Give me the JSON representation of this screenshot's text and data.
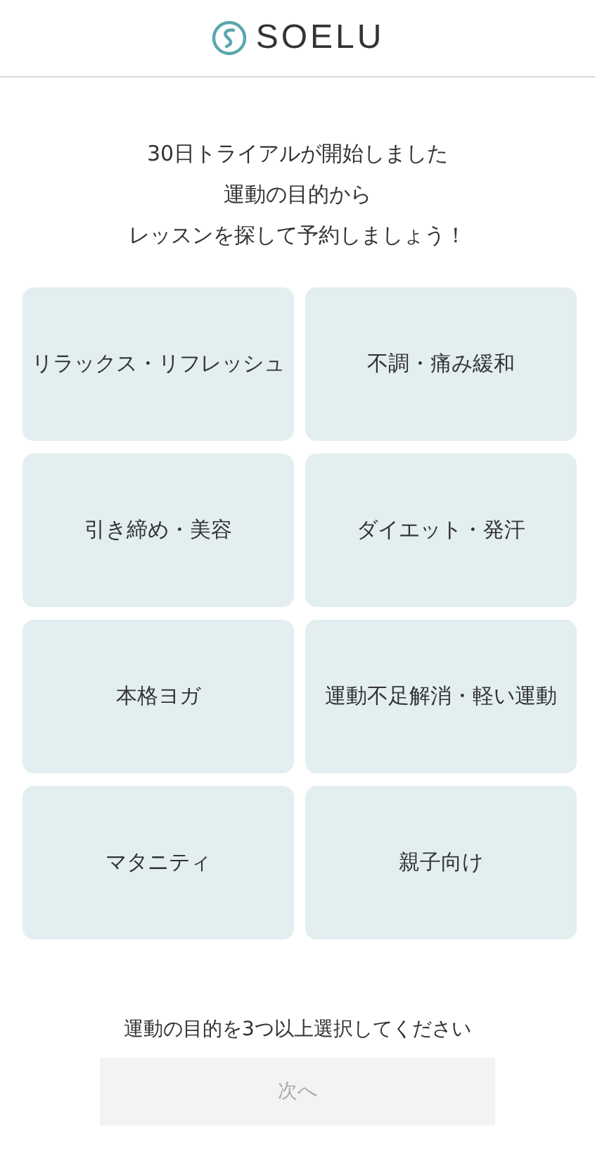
{
  "header": {
    "logo_text": "SOELU"
  },
  "intro_lines": [
    "30日トライアルが開始しました",
    "運動の目的から",
    "レッスンを探して予約しましょう！"
  ],
  "purposes": [
    {
      "label": "リラックス・リフレッシュ",
      "selected": false
    },
    {
      "label": "不調・痛み緩和",
      "selected": false
    },
    {
      "label": "引き締め・美容",
      "selected": false
    },
    {
      "label": "ダイエット・発汗",
      "selected": false
    },
    {
      "label": "本格ヨガ",
      "selected": false
    },
    {
      "label": "運動不足解消・軽い運動",
      "selected": false
    },
    {
      "label": "マタニティ",
      "selected": false
    },
    {
      "label": "親子向け",
      "selected": false
    }
  ],
  "note": "運動の目的を3つ以上選択してください",
  "next_button": {
    "label": "次へ",
    "disabled": true
  }
}
